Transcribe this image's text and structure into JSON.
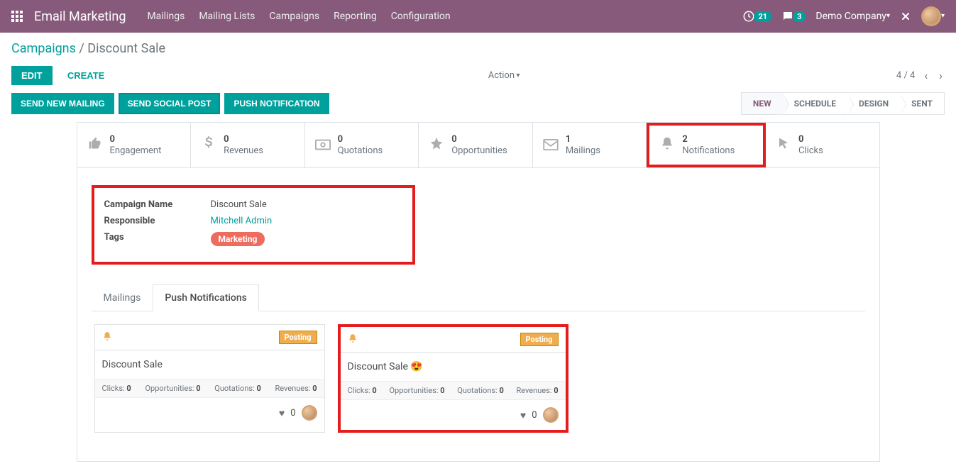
{
  "header": {
    "brand": "Email Marketing",
    "menu": [
      "Mailings",
      "Mailing Lists",
      "Campaigns",
      "Reporting",
      "Configuration"
    ],
    "activities_count": "21",
    "messages_count": "3",
    "company": "Demo Company"
  },
  "breadcrumb": {
    "parent": "Campaigns",
    "sep": " / ",
    "current": "Discount Sale"
  },
  "controls": {
    "edit": "EDIT",
    "create": "CREATE",
    "action": "Action",
    "pager": "4 / 4"
  },
  "status_buttons": {
    "send_mailing": "SEND NEW MAILING",
    "send_social": "SEND SOCIAL POST",
    "push_notif": "PUSH NOTIFICATION"
  },
  "stages": [
    "NEW",
    "SCHEDULE",
    "DESIGN",
    "SENT"
  ],
  "stats": {
    "engagement": {
      "val": "0",
      "label": "Engagement"
    },
    "revenues": {
      "val": "0",
      "label": "Revenues"
    },
    "quotations": {
      "val": "0",
      "label": "Quotations"
    },
    "opportunities": {
      "val": "0",
      "label": "Opportunities"
    },
    "mailings": {
      "val": "1",
      "label": "Mailings"
    },
    "notifications": {
      "val": "2",
      "label": "Notifications"
    },
    "clicks": {
      "val": "0",
      "label": "Clicks"
    }
  },
  "form": {
    "labels": {
      "campaign": "Campaign Name",
      "responsible": "Responsible",
      "tags": "Tags"
    },
    "campaign_name": "Discount Sale",
    "responsible": "Mitchell Admin",
    "tag": "Marketing"
  },
  "tabs": {
    "mailings": "Mailings",
    "push": "Push Notifications"
  },
  "card_badge": "Posting",
  "card_stat_labels": {
    "clicks": "Clicks:",
    "opp": "Opportunities:",
    "quo": "Quotations:",
    "rev": "Revenues:"
  },
  "cards": [
    {
      "title": "Discount Sale",
      "clicks": "0",
      "opp": "0",
      "quo": "0",
      "rev": "0",
      "likes": "0"
    },
    {
      "title": "Discount Sale 😍",
      "clicks": "0",
      "opp": "0",
      "quo": "0",
      "rev": "0",
      "likes": "0"
    }
  ]
}
